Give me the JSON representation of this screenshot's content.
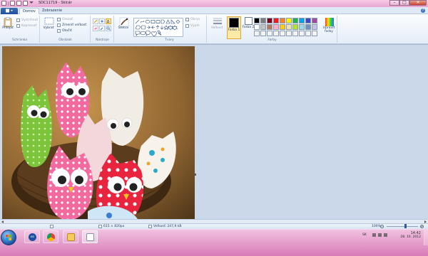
{
  "window": {
    "title": "SDC11719 - Skicár",
    "minimize_glyph": "–",
    "maximize_glyph": "□",
    "close_glyph": "✕"
  },
  "tabs": {
    "file_label": "",
    "items": [
      {
        "label": "Domov",
        "active": true
      },
      {
        "label": "Zobrazenie",
        "active": false
      }
    ],
    "help_glyph": "?"
  },
  "ribbon": {
    "clipboard": {
      "group_label": "Schránka",
      "paste_label": "Prilepiť",
      "cut_label": "Vystrihnúť",
      "copy_label": "Kopírovať"
    },
    "image": {
      "group_label": "Obrázok",
      "select_label": "Vybrať",
      "crop_label": "Orezať",
      "resize_label": "Zmeniť veľkosť",
      "rotate_label": "Otočiť"
    },
    "tools": {
      "group_label": "Nástroje",
      "brushes_label": "Štetce"
    },
    "shapes": {
      "group_label": "Tvary",
      "outline_label": "Obrys",
      "fill_label": "Výplň"
    },
    "colors": {
      "group_label": "Farby",
      "size_label": "Veľkosť",
      "color1_label": "Farba 1",
      "color2_label": "Farba 2",
      "edit_colors_label": "Upraviť farby",
      "color1": "#000000",
      "color2": "#ffffff",
      "palette": [
        "#000000",
        "#7f7f7f",
        "#880015",
        "#ed1c24",
        "#ff7f27",
        "#fff200",
        "#22b14c",
        "#00a2e8",
        "#3f48cc",
        "#a349a4",
        "#ffffff",
        "#c3c3c3",
        "#b97a57",
        "#ffaec9",
        "#ffc90e",
        "#efe4b0",
        "#b5e61d",
        "#99d9ea",
        "#7092be",
        "#c8bfe7",
        "#f3f3f3",
        "#f3f3f3",
        "#f3f3f3",
        "#f3f3f3",
        "#f3f3f3",
        "#f3f3f3",
        "#f3f3f3",
        "#f3f3f3",
        "#f3f3f3",
        "#f3f3f3"
      ]
    }
  },
  "status": {
    "dimensions": "615 × 820px",
    "filesize": "Veľkosť: 247,9 kB",
    "zoom": "100%"
  },
  "taskbar": {
    "apps": [
      {
        "name": "start-button"
      },
      {
        "name": "kis-app",
        "label": "KIS"
      },
      {
        "name": "chrome-app"
      },
      {
        "name": "explorer-app"
      },
      {
        "name": "paint-app",
        "active": true
      }
    ],
    "language": "SK",
    "time": "14:42",
    "date": "28. 10. 2012"
  }
}
